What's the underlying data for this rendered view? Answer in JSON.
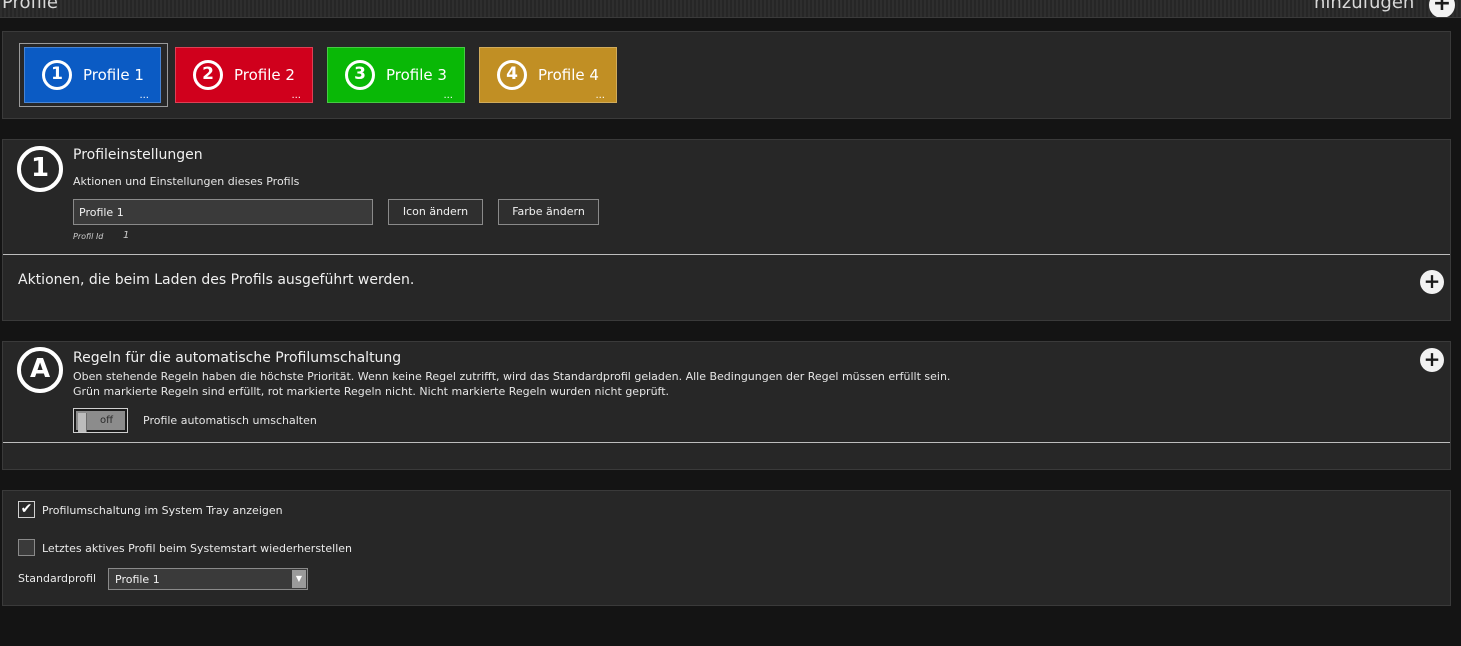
{
  "header": {
    "title": "Profile",
    "add_label": "hinzufügen",
    "add_icon": "plus-circle-icon"
  },
  "profiles": [
    {
      "number": "1",
      "label": "Profile 1",
      "color": "#0b5bc4",
      "more": "...",
      "selected": true
    },
    {
      "number": "2",
      "label": "Profile 2",
      "color": "#d0001c",
      "more": "...",
      "selected": false
    },
    {
      "number": "3",
      "label": "Profile 3",
      "color": "#09b806",
      "more": "...",
      "selected": false
    },
    {
      "number": "4",
      "label": "Profile 4",
      "color": "#c18f24",
      "more": "...",
      "selected": false
    }
  ],
  "settings": {
    "icon_number": "1",
    "title": "Profileinstellungen",
    "subtitle": "Aktionen und Einstellungen dieses Profils",
    "name_value": "Profile 1",
    "icon_button": "Icon ändern",
    "color_button": "Farbe ändern",
    "id_label": "Profil Id",
    "id_value": "1",
    "load_actions": "Aktionen, die beim Laden des Profils ausgeführt werden."
  },
  "rules": {
    "icon_letter": "A",
    "title": "Regeln für die automatische Profilumschaltung",
    "line1": "Oben stehende Regeln haben die höchste Priorität. Wenn keine Regel zutrifft, wird das Standardprofil geladen. Alle Bedingungen der Regel müssen erfüllt sein.",
    "line2": "Grün markierte Regeln sind erfüllt, rot markierte Regeln nicht. Nicht markierte Regeln wurden nicht geprüft.",
    "toggle_state": "off",
    "toggle_label": "Profile automatisch umschalten"
  },
  "options": {
    "tray_label": "Profilumschaltung im System Tray anzeigen",
    "tray_checked": true,
    "restore_label": "Letztes aktives Profil beim Systemstart wiederherstellen",
    "restore_checked": false,
    "default_label": "Standardprofil",
    "default_value": "Profile 1"
  }
}
